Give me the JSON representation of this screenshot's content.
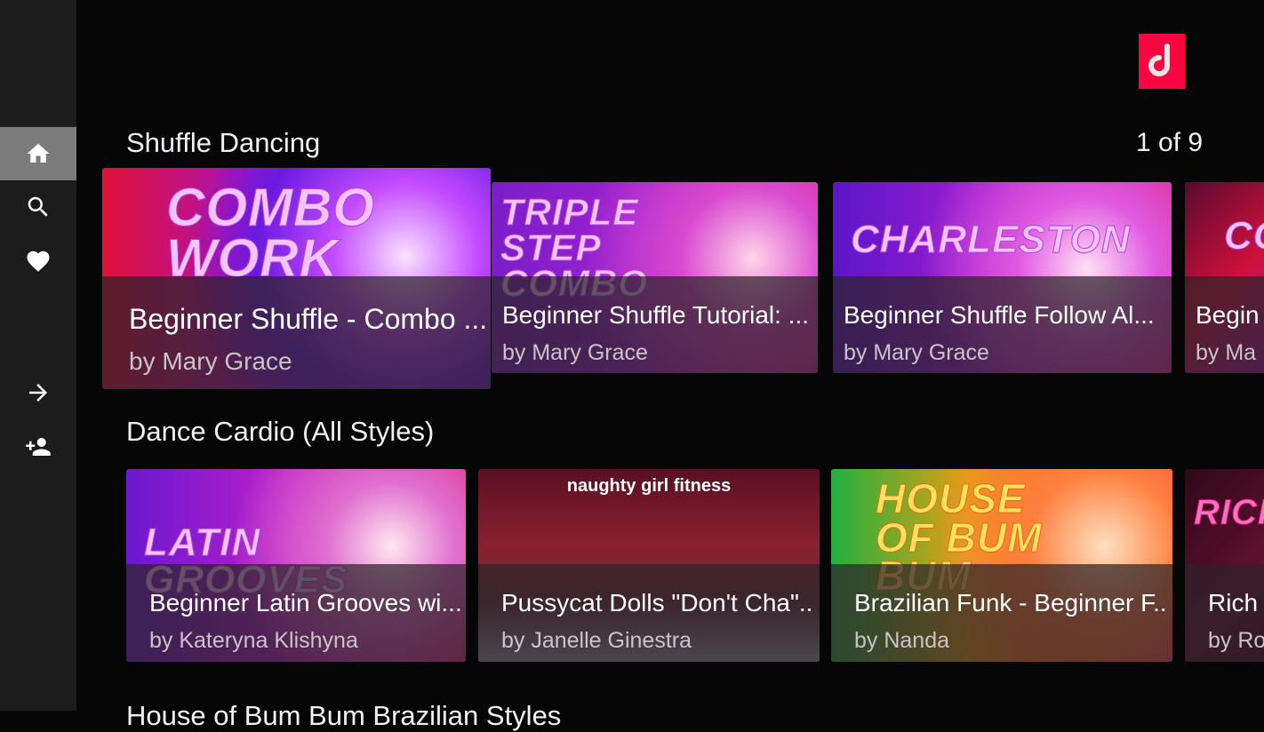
{
  "sidebar": {
    "items": [
      {
        "name": "home",
        "icon": "home-icon",
        "active": true
      },
      {
        "name": "search",
        "icon": "search-icon"
      },
      {
        "name": "favorites",
        "icon": "heart-icon"
      },
      {
        "name": "sign-in",
        "icon": "arrow-right-icon"
      },
      {
        "name": "sign-up",
        "icon": "person-add-icon"
      }
    ]
  },
  "logo": {
    "letter": "d",
    "color": "#f7063f"
  },
  "rows": [
    {
      "title": "Shuffle Dancing",
      "pager": "1 of 9",
      "cards": [
        {
          "title": "Beginner Shuffle - Combo ...",
          "author": "by Mary Grace",
          "art": "COMBO WORK"
        },
        {
          "title": "Beginner Shuffle Tutorial: ...",
          "author": "by Mary Grace",
          "art": "TRIPLE STEP COMBO"
        },
        {
          "title": "Beginner Shuffle Follow Al...",
          "author": "by Mary Grace",
          "art": "CHARLESTON"
        },
        {
          "title": "Begin",
          "author": "by Ma",
          "art": "CO"
        }
      ]
    },
    {
      "title": "Dance Cardio (All Styles)",
      "cards": [
        {
          "title": "Beginner Latin Grooves wi...",
          "author": "by Kateryna Klishyna",
          "art": "LATIN GROOVES"
        },
        {
          "title": "Pussycat Dolls \"Don't Cha\"...",
          "author": "by Janelle Ginestra",
          "art": "naughty girl fitness"
        },
        {
          "title": "Brazilian Funk - Beginner F...",
          "author": "by Nanda",
          "art": "HOUSE OF BUM BUM"
        },
        {
          "title": "Rich",
          "author": "by Ro",
          "art": "RICH &"
        }
      ]
    },
    {
      "title": "House of Bum Bum Brazilian Styles"
    }
  ]
}
